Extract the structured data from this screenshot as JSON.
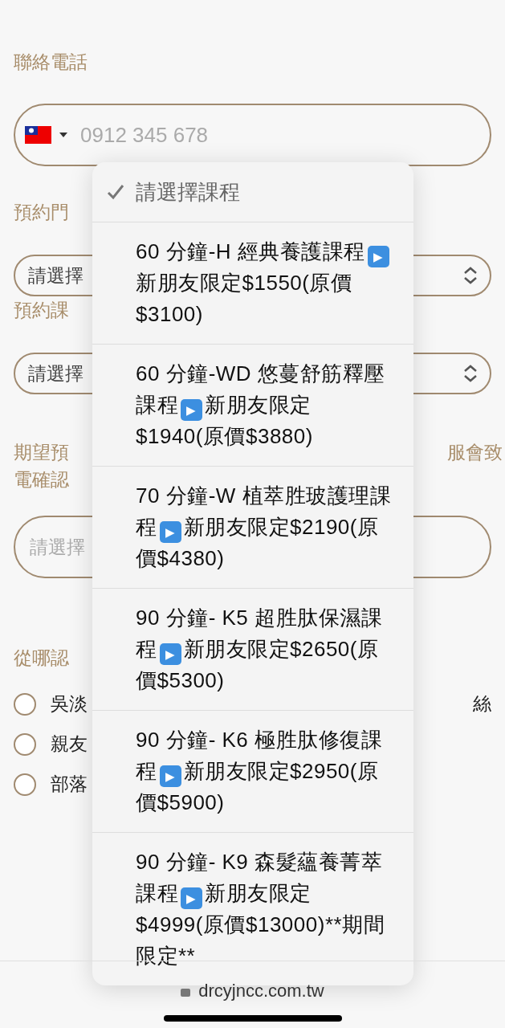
{
  "form": {
    "phone_label": "聯絡電話",
    "phone_placeholder": "0912 345 678",
    "store_label": "預約門",
    "store_select": "請選擇",
    "course_label": "預約課",
    "course_select": "請選擇",
    "time_label_lines": [
      "期望預",
      "電確認"
    ],
    "time_label_right": "服會致",
    "time_placeholder": "請選擇",
    "source_label": "從哪認",
    "source_options": [
      {
        "label": "吳淡",
        "right": "絲",
        "selected": false
      },
      {
        "label": "親友",
        "selected": false
      },
      {
        "label": "部落",
        "selected": false
      }
    ]
  },
  "dropdown": {
    "options": [
      {
        "kind": "placeholder",
        "text": "請選擇課程",
        "selected": true
      },
      {
        "kind": "course",
        "course": "60 分鐘-H 經典養護課程",
        "play": "▶",
        "offer": "新朋友限定$1550(原價$3100)",
        "selected": false
      },
      {
        "kind": "course",
        "course": "60 分鐘-WD 悠蔓舒筋釋壓課程",
        "play": "▶",
        "offer": "新朋友限定$1940(原價$3880)",
        "selected": false
      },
      {
        "kind": "course",
        "course": "70 分鐘-W 植萃胜玻護理課程",
        "play": "▶",
        "offer": "新朋友限定$2190(原價$4380)",
        "selected": false
      },
      {
        "kind": "course",
        "course": "90 分鐘- K5 超胜肽保濕課程",
        "play": "▶",
        "offer": "新朋友限定$2650(原價$5300)",
        "selected": false
      },
      {
        "kind": "course",
        "course": "90 分鐘- K6 極胜肽修復課程",
        "play": "▶",
        "offer": "新朋友限定$2950(原價$5900)",
        "selected": false
      },
      {
        "kind": "course",
        "course": "90 分鐘- K9 森髮蘊養菁萃課程",
        "play": "▶",
        "offer": "新朋友限定$4999(原價$13000)**期間限定**",
        "selected": false
      }
    ]
  },
  "url_bar": {
    "url": "drcyjncc.com.tw"
  }
}
